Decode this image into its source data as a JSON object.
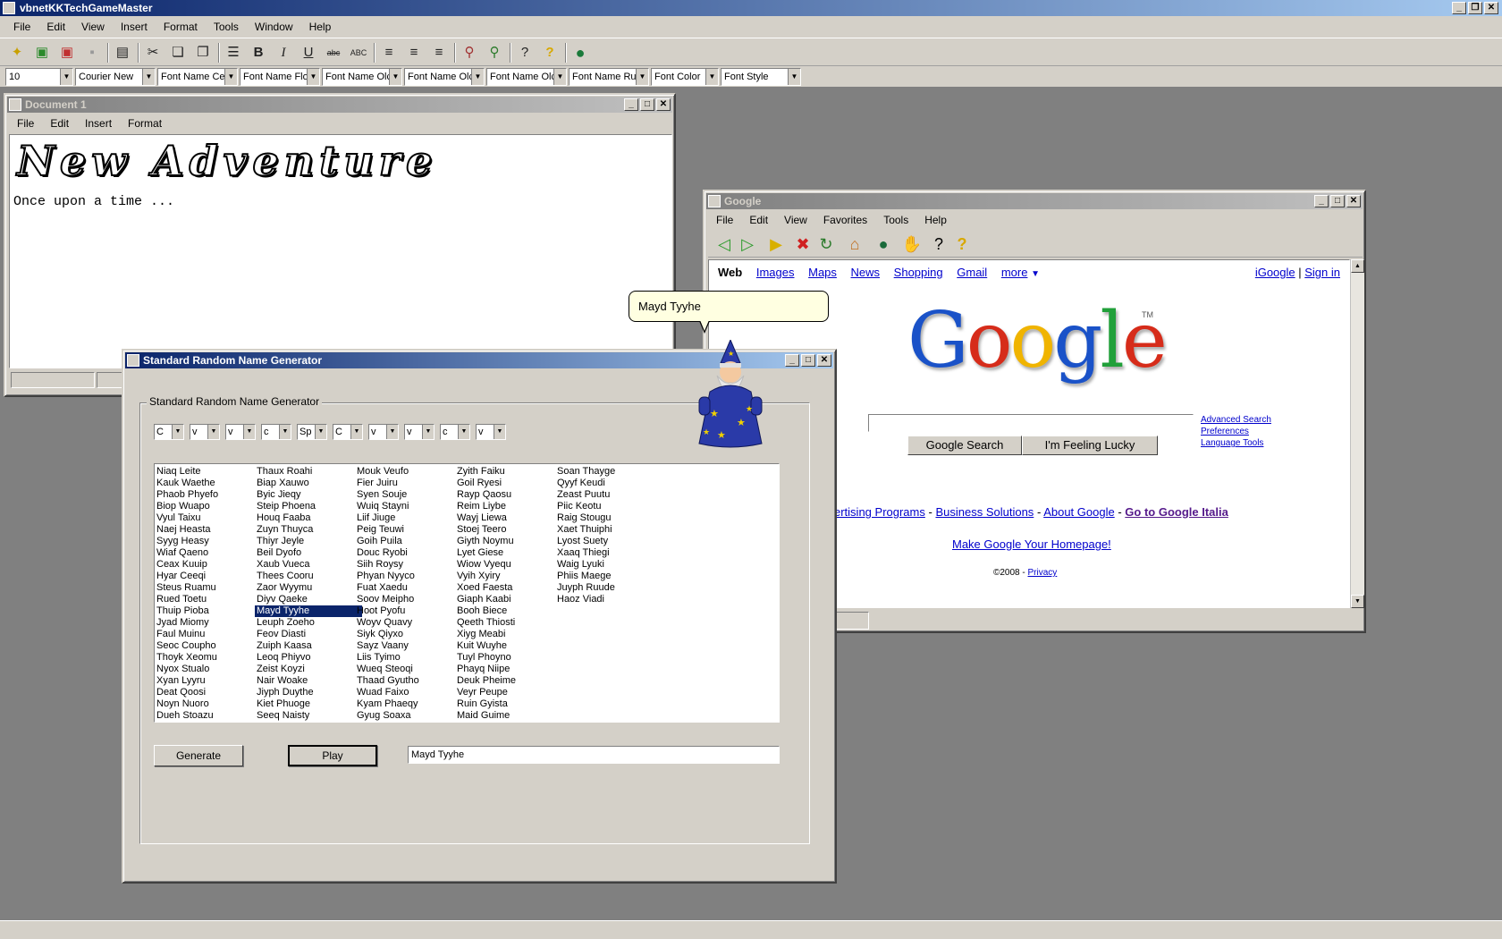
{
  "app": {
    "title": "vbnetKKTechGameMaster",
    "menu": [
      "File",
      "Edit",
      "View",
      "Insert",
      "Format",
      "Tools",
      "Window",
      "Help"
    ],
    "fontbar": {
      "size": "10",
      "font": "Courier New",
      "combos": [
        "Font Name Ce",
        "Font Name Flo",
        "Font Name Olc",
        "Font Name Olc",
        "Font Name Olc",
        "Font Name Ru",
        "Font Color",
        "Font Style"
      ]
    }
  },
  "document": {
    "title": "Document 1",
    "menu": [
      "File",
      "Edit",
      "Insert",
      "Format"
    ],
    "heading": "New Adventure",
    "body": "Once upon a time ..."
  },
  "browser": {
    "title": "Google",
    "menu": [
      "File",
      "Edit",
      "View",
      "Favorites",
      "Tools",
      "Help"
    ],
    "nav": [
      "Web",
      "Images",
      "Maps",
      "News",
      "Shopping",
      "Gmail",
      "more"
    ],
    "right_links": [
      "iGoogle",
      "Sign in"
    ],
    "logo": "Google",
    "tm": "TM",
    "search_button": "Google Search",
    "lucky_button": "I'm Feeling Lucky",
    "side_links": [
      "Advanced Search",
      "Preferences",
      "Language Tools"
    ],
    "footer": {
      "ad": "ertising Programs",
      "business": "Business Solutions",
      "about": "About Google",
      "italia": "Go to Google Italia",
      "sep": "-"
    },
    "homepage": "Make Google Your Homepage!",
    "copyright": "©2008 -",
    "privacy": "Privacy"
  },
  "generator": {
    "title": "Standard Random Name Generator",
    "group_label": "Standard Random Name Generator",
    "patterns": [
      "C",
      "v",
      "v",
      "c",
      "Sp",
      "C",
      "v",
      "v",
      "c",
      "v"
    ],
    "columns": [
      [
        "Niaq Leite",
        "Kauk Waethe",
        "Phaob Phyefo",
        "Biop Wuapo",
        "Vyul Taixu",
        "Naej Heasta",
        "Syyg Heasy",
        "Wiaf Qaeno",
        "Ceax Kuuip",
        "Hyar Ceeqi",
        "Steus Ruamu",
        "Rued Toetu",
        "Thuip Pioba",
        "Jyad Miomy",
        "Faul Muinu",
        "Seoc Coupho",
        "Thoyk Xeomu",
        "Nyox Stualo",
        "Xyan Lyyru",
        "Deat Qoosi",
        "Noyn Nuoro",
        "Dueh Stoazu"
      ],
      [
        "Thaux Roahi",
        "Biap Xauwo",
        "Byic Jieqy",
        "Steip Phoena",
        "Houq Faaba",
        "Zuyn Thuyca",
        "Thiyr Jeyle",
        "Beil Dyofo",
        "Xaub Vueca",
        "Thees Cooru",
        "Zaor Wyymu",
        "Diyv Qaeke",
        "Mayd Tyyhe",
        "Leuph Zoeho",
        "Feov Diasti",
        "Zuiph Kaasa",
        "Leoq Phiyvo",
        "Zeist Koyzi",
        "Nair Woake",
        "Jiyph Duythe",
        "Kiet Phuoge",
        "Seeq Naisty"
      ],
      [
        "Mouk Veufo",
        "Fier Juiru",
        "Syen Souje",
        "Wuiq Stayni",
        "Liif Jiuge",
        "Peig Teuwi",
        "Goih Puila",
        "Douc Ryobi",
        "Siih Roysy",
        "Phyan Nyyco",
        "Fuat Xaedu",
        "Soov Meipho",
        "Hoot Pyofu",
        "Woyv Quavy",
        "Siyk Qiyxo",
        "Sayz Vaany",
        "Liis Tyimo",
        "Wueq Steoqi",
        "Thaad Gyutho",
        "Wuad Faixo",
        "Kyam Phaeqy",
        "Gyug Soaxa"
      ],
      [
        "Zyith Faiku",
        "Goil Ryesi",
        "Rayp Qaosu",
        "Reim Liybe",
        "Wayj Liewa",
        "Stoej Teero",
        "Giyth Noymu",
        "Lyet Giese",
        "Wiow Vyequ",
        "Vyih Xyiry",
        "Xoed Faesta",
        "Giaph Kaabi",
        "Booh Biece",
        "Qeeth Thiosti",
        "Xiyg Meabi",
        "Kuit Wuyhe",
        "Tuyl Phoyno",
        "Phayq Niipe",
        "Deuk Pheime",
        "Veyr Peupe",
        "Ruin Gyista",
        "Maid Guime"
      ],
      [
        "Soan Thayge",
        "Qyyf Keudi",
        "Zeast Puutu",
        "Piic Keotu",
        "Raig Stougu",
        "Xaet Thuiphi",
        "Lyost Suety",
        "Xaaq Thiegi",
        "Waig Lyuki",
        "Phiis Maege",
        "Juyph Ruude",
        "Haoz Viadi"
      ]
    ],
    "selected": "Mayd Tyyhe",
    "generate_button": "Generate",
    "play_button": "Play",
    "output_value": "Mayd Tyyhe"
  },
  "wizard": {
    "speech": "Mayd Tyyhe"
  }
}
